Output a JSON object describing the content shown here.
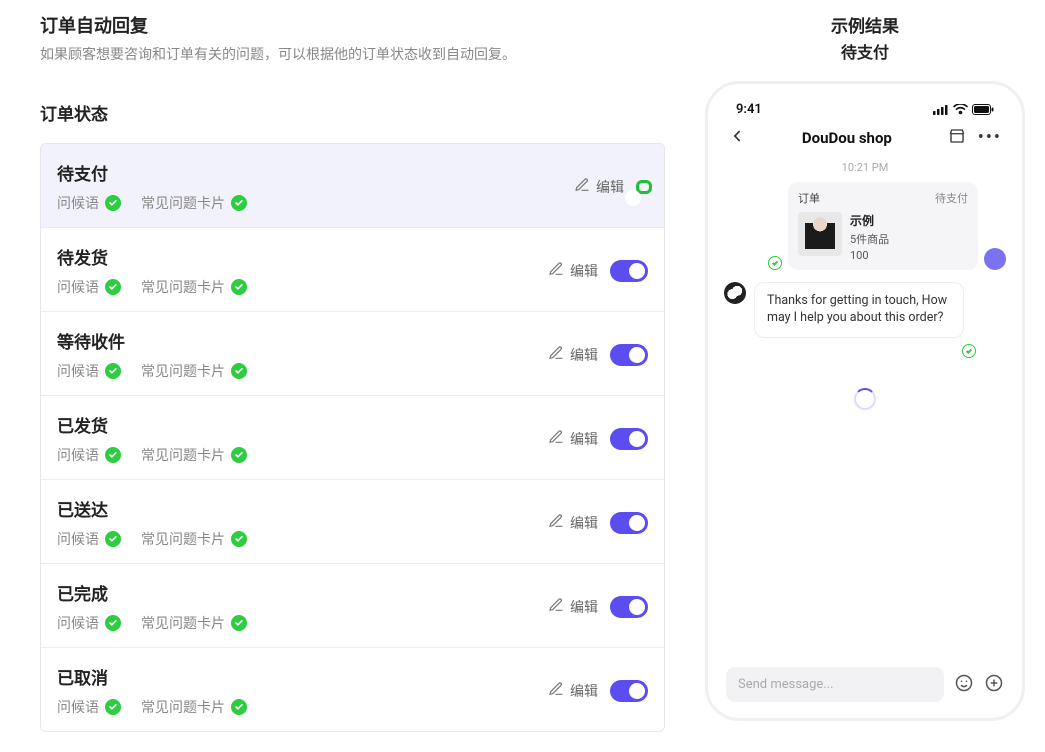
{
  "header": {
    "title": "订单自动回复",
    "description": "如果顾客想要咨询和订单有关的问题，可以根据他的订单状态收到自动回复。"
  },
  "order_status": {
    "heading": "订单状态",
    "tag_greeting": "问候语",
    "tag_faq_card": "常见问题卡片",
    "edit_label": "编辑",
    "items": [
      {
        "title": "待支付",
        "selected": true,
        "toggle_on": true,
        "highlight_toggle": true
      },
      {
        "title": "待发货",
        "selected": false,
        "toggle_on": true,
        "highlight_toggle": false
      },
      {
        "title": "等待收件",
        "selected": false,
        "toggle_on": true,
        "highlight_toggle": false
      },
      {
        "title": "已发货",
        "selected": false,
        "toggle_on": true,
        "highlight_toggle": false
      },
      {
        "title": "已送达",
        "selected": false,
        "toggle_on": true,
        "highlight_toggle": false
      },
      {
        "title": "已完成",
        "selected": false,
        "toggle_on": true,
        "highlight_toggle": false
      },
      {
        "title": "已取消",
        "selected": false,
        "toggle_on": true,
        "highlight_toggle": false
      }
    ]
  },
  "preview": {
    "title": "示例结果",
    "subtitle": "待支付",
    "statusbar_time": "9:41",
    "shop_name": "DouDou shop",
    "timestamp": "10:21 PM",
    "order_card": {
      "label": "订单",
      "status": "待支付",
      "product_name": "示例",
      "product_qty": "5件商品",
      "product_price": "100"
    },
    "bot_message": "Thanks for getting in touch, How may I help you about this order?",
    "composer_placeholder": "Send message..."
  }
}
